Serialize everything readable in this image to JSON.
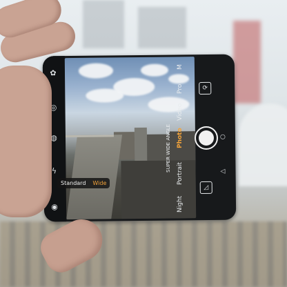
{
  "scene": {
    "description_icons": [
      "settings-icon",
      "timer-icon",
      "flash-icon",
      "filter-icon",
      "gallery-icon",
      "switch-camera-icon"
    ]
  },
  "camera_app": {
    "modes": {
      "night": "Night",
      "portrait": "Portrait",
      "photo": "Photo",
      "video": "Video",
      "pro": "Pro",
      "more": "M"
    },
    "selected_mode": "photo",
    "wide_angle_label": "SUPER WIDE ANGLE",
    "zoom_options": [
      "Standard",
      "Wide"
    ],
    "selected_zoom": "Wide",
    "colors": {
      "accent": "#f3a33a",
      "ui": "#f1f1f1"
    }
  }
}
